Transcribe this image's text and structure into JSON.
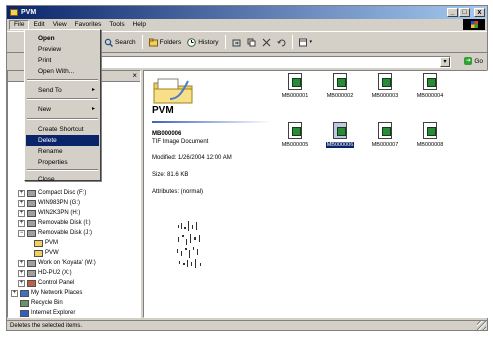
{
  "window": {
    "title": "PVM"
  },
  "caption_buttons": {
    "minimize": "_",
    "maximize": "□",
    "close": "x"
  },
  "menubar": [
    "File",
    "Edit",
    "View",
    "Favorites",
    "Tools",
    "Help"
  ],
  "toolbar": {
    "search": "Search",
    "folders": "Folders",
    "history": "History"
  },
  "address": {
    "go": "Go"
  },
  "file_menu": {
    "items": [
      {
        "label": "Open",
        "bold": true
      },
      {
        "label": "Preview"
      },
      {
        "label": "Print"
      },
      {
        "label": "Open With..."
      },
      {
        "label": "Send To",
        "submenu": true
      },
      {
        "label": "New",
        "submenu": true
      },
      {
        "label": "Create Shortcut"
      },
      {
        "label": "Delete",
        "highlighted": true
      },
      {
        "label": "Rename"
      },
      {
        "label": "Properties"
      },
      {
        "label": "Close"
      }
    ],
    "arrow": "▸"
  },
  "left_pane": {
    "close": "×",
    "tree": [
      {
        "label": "Compact Disc (F:)",
        "indent": 2,
        "expander": "+"
      },
      {
        "label": "WIN983PN (G:)",
        "indent": 2,
        "expander": "+"
      },
      {
        "label": "WIN2K3PN (H:)",
        "indent": 2,
        "expander": "+"
      },
      {
        "label": "Removable Disk (I:)",
        "indent": 2,
        "expander": "+"
      },
      {
        "label": "Removable Disk (J:)",
        "indent": 2,
        "expander": "−"
      },
      {
        "label": "PVM",
        "indent": 3,
        "expander": ""
      },
      {
        "label": "PVW",
        "indent": 3,
        "expander": ""
      },
      {
        "label": "Work on 'Koyata' (W:)",
        "indent": 2,
        "expander": "+"
      },
      {
        "label": "HD-PU2 (X:)",
        "indent": 2,
        "expander": "+"
      },
      {
        "label": "Control Panel",
        "indent": 2,
        "expander": "+"
      },
      {
        "label": "My Network Places",
        "indent": 1,
        "expander": "+"
      },
      {
        "label": "Recycle Bin",
        "indent": 1,
        "expander": ""
      },
      {
        "label": "Internet Explorer",
        "indent": 1,
        "expander": ""
      }
    ]
  },
  "details": {
    "folder": "PVM",
    "file_name": "MB000006",
    "file_type": "TIF Image Document",
    "modified": "Modified: 1/26/2004 12:00 AM",
    "size": "Size: 81.6 KB",
    "attributes": "Attributes: (normal)"
  },
  "files": [
    {
      "name": "MB000001",
      "selected": false
    },
    {
      "name": "MB000002",
      "selected": false
    },
    {
      "name": "MB000003",
      "selected": false
    },
    {
      "name": "MB000004",
      "selected": false
    },
    {
      "name": "MB000005",
      "selected": false
    },
    {
      "name": "MB000006",
      "selected": true
    },
    {
      "name": "MB000007",
      "selected": false
    },
    {
      "name": "MB000008",
      "selected": false
    }
  ],
  "status": {
    "text": "Deletes the selected items."
  },
  "colors": {
    "title_start": "#0a246a",
    "title_end": "#a6caf0",
    "selection": "#0a246a",
    "chrome": "#d4d0c8"
  }
}
